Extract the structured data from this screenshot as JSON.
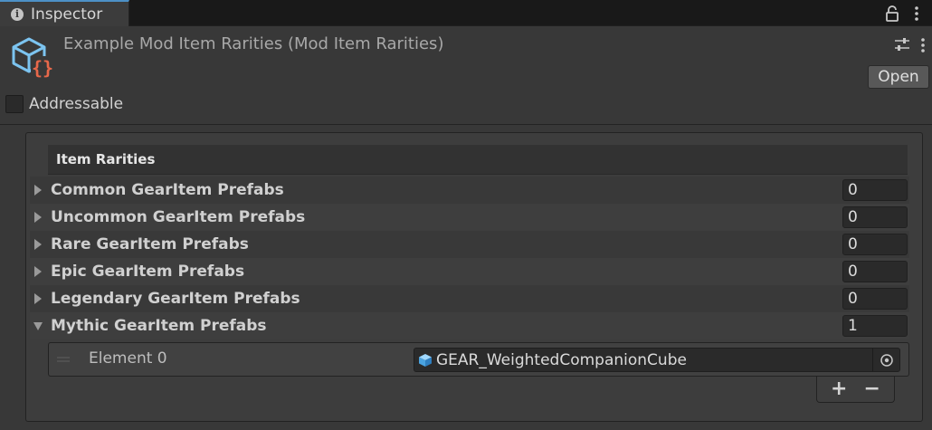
{
  "window": {
    "tab_label": "Inspector",
    "icons": {
      "tab": "info-icon",
      "lock": "lock-icon",
      "tab_menu": "kebab-menu-icon"
    }
  },
  "header": {
    "asset_title": "Example Mod Item Rarities (Mod Item Rarities)",
    "asset_icon": "scriptable-object-icon",
    "open_label": "Open",
    "addressable_label": "Addressable",
    "addressable_checked": false
  },
  "item_rarities": {
    "header": "Item Rarities",
    "rows": [
      {
        "label": "Common GearItem Prefabs",
        "count": "0",
        "expanded": false
      },
      {
        "label": "Uncommon GearItem Prefabs",
        "count": "0",
        "expanded": false
      },
      {
        "label": "Rare GearItem Prefabs",
        "count": "0",
        "expanded": false
      },
      {
        "label": "Epic GearItem Prefabs",
        "count": "0",
        "expanded": false
      },
      {
        "label": "Legendary GearItem Prefabs",
        "count": "0",
        "expanded": false
      },
      {
        "label": "Mythic GearItem Prefabs",
        "count": "1",
        "expanded": true
      }
    ],
    "mythic_elements": [
      {
        "label": "Element 0",
        "value": "GEAR_WeightedCompanionCube",
        "icon": "prefab-cube-icon"
      }
    ],
    "add_label": "+",
    "remove_label": "−"
  },
  "colors": {
    "background": "#383838",
    "tab_accent": "#4d90c6",
    "icon_blue": "#7cc4f0",
    "icon_orange": "#e8684a"
  }
}
